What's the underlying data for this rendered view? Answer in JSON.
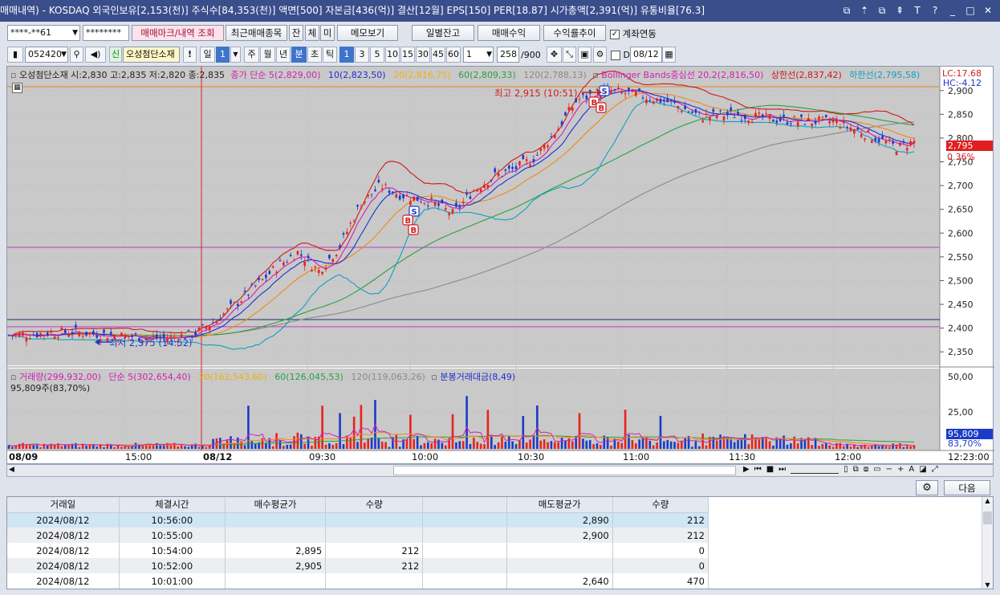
{
  "window": {
    "title": "매매내역) - KOSDAQ 외국인보유[2,153(천)] 주식수[84,353(천)] 액면[500] 자본금[436(억)] 결산[12월] EPS[150] PER[18.87] 시가총액[2,391(억)] 유통비율[76.3]",
    "buttons": [
      "⧉",
      "⇡",
      "⧉",
      "⇞",
      "T",
      "?",
      "_",
      "□",
      "✕"
    ]
  },
  "toolbar1": {
    "account": "****-**61",
    "password": "********",
    "query_button": "매매마크/내역 조회",
    "recent_button": "최근매매종목",
    "tab1": "잔",
    "tab2": "체",
    "tab3": "미",
    "memo_button": "메모보기",
    "daily_balance_button": "일별잔고",
    "trade_profit_button": "매매수익",
    "return_trend_button": "수익률추이",
    "link_account_label": "계좌연동",
    "link_account_checked": true
  },
  "toolbar2": {
    "code": "052420",
    "credit_badge": "신",
    "stock_name": "오성첨단소재",
    "period_day": "일",
    "period_day_value": "1",
    "period_week": "주",
    "period_month": "월",
    "period_year": "년",
    "period_min": "분",
    "period_sec": "초",
    "period_tick": "틱",
    "min_options": [
      "1",
      "3",
      "5",
      "10",
      "15",
      "30",
      "45",
      "60"
    ],
    "min_selected": "1",
    "interval_value": "1",
    "count_value": "258",
    "count_max": "/900",
    "date_label": "D",
    "date_value": "08/12"
  },
  "chart_data": {
    "type": "candlestick",
    "price_legend": {
      "name_ohlc": "오성첨단소재 시:2,830 고:2,835 저:2,820 종:2,835",
      "ma5": "종가 단순 5(2,829,00)",
      "ma10": "10(2,823,50)",
      "ma20": "20(2,816,75)",
      "ma60": "60(2,809,33)",
      "ma120": "120(2,788,13)",
      "bb_mid": "Bollinger Bands중심선 20,2(2,816,50)",
      "bb_upper": "상한선(2,837,42)",
      "bb_lower": "하한선(2,795,58)"
    },
    "price_axis": {
      "ticks": [
        "2,900",
        "2,850",
        "2,800",
        "2,750",
        "2,700",
        "2,650",
        "2,600",
        "2,550",
        "2,500",
        "2,450",
        "2,400",
        "2,350"
      ],
      "values": [
        2900,
        2850,
        2800,
        2750,
        2700,
        2650,
        2600,
        2550,
        2500,
        2450,
        2400,
        2350
      ],
      "range": [
        2325,
        2930
      ],
      "current_price": "2,795",
      "current_change": "0.36%",
      "lc_label": "LC:17.68",
      "hc_label": "HC:-4.12"
    },
    "annotations": {
      "high": "최고 2,915 (10:51)",
      "low": "최저 2,375 (14:52)",
      "marks": [
        "S",
        "B",
        "B"
      ]
    },
    "horizontal_lines": [
      {
        "price": 2908,
        "color": "#e8851a"
      },
      {
        "price": 2570,
        "color": "#c040c0"
      },
      {
        "price": 2418,
        "color": "#1e2a70"
      },
      {
        "price": 2403,
        "color": "#c040c0"
      }
    ],
    "volume_legend": {
      "vol": "거래량(299,932,00)",
      "ma5": "단순 5(302,654,40)",
      "ma20": "20(162,543,60)",
      "ma60": "60(126,045,53)",
      "ma120": "120(119,063,26)",
      "amount": "분봉거래대금(8,49)",
      "sub": "95,809주(83,70%)"
    },
    "volume_axis": {
      "ticks": [
        "50,00",
        "25,00"
      ],
      "current": "95,809",
      "current_pct": "83,70%"
    },
    "time_axis": {
      "labels": [
        "08/09",
        "15:00",
        "08/12",
        "09:30",
        "10:00",
        "10:30",
        "11:00",
        "11:30",
        "12:00",
        "12:23:00"
      ]
    },
    "colors": {
      "up": "#e8231c",
      "down": "#1a3cc8",
      "ma5": "#d21fb4",
      "ma10": "#1c2fd0",
      "ma20": "#f08a12",
      "ma60": "#2aa040",
      "ma120": "#8a8a8a",
      "bb_upper": "#d01818",
      "bb_lower": "#10a0c0"
    }
  },
  "bottom_toolbar": {
    "settings_icon": "gear-icon",
    "next_button": "다음"
  },
  "table": {
    "headers": [
      "거래일",
      "체결시간",
      "매수평균가",
      "수량",
      "",
      "매도평균가",
      "수량"
    ],
    "rows": [
      [
        "2024/08/12",
        "10:56:00",
        "",
        "",
        "",
        "2,890",
        "212"
      ],
      [
        "2024/08/12",
        "10:55:00",
        "",
        "",
        "",
        "2,900",
        "212"
      ],
      [
        "2024/08/12",
        "10:54:00",
        "2,895",
        "212",
        "",
        "",
        "0"
      ],
      [
        "2024/08/12",
        "10:52:00",
        "2,905",
        "212",
        "",
        "",
        "0"
      ],
      [
        "2024/08/12",
        "10:01:00",
        "",
        "",
        "",
        "2,640",
        "470"
      ]
    ]
  }
}
